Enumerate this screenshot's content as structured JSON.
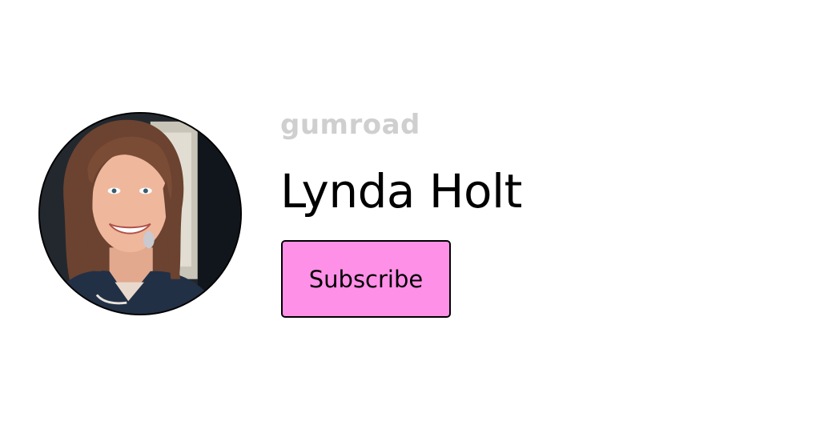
{
  "brand": {
    "logo_text": "GUMROAD"
  },
  "creator": {
    "name": "Lynda Holt",
    "avatar_icon": "profile-photo"
  },
  "actions": {
    "subscribe_label": "Subscribe"
  },
  "colors": {
    "background": "#ffffff",
    "button_fill": "#ff90e8",
    "button_border": "#000000",
    "logo": "#cfcfcf",
    "text": "#000000"
  }
}
